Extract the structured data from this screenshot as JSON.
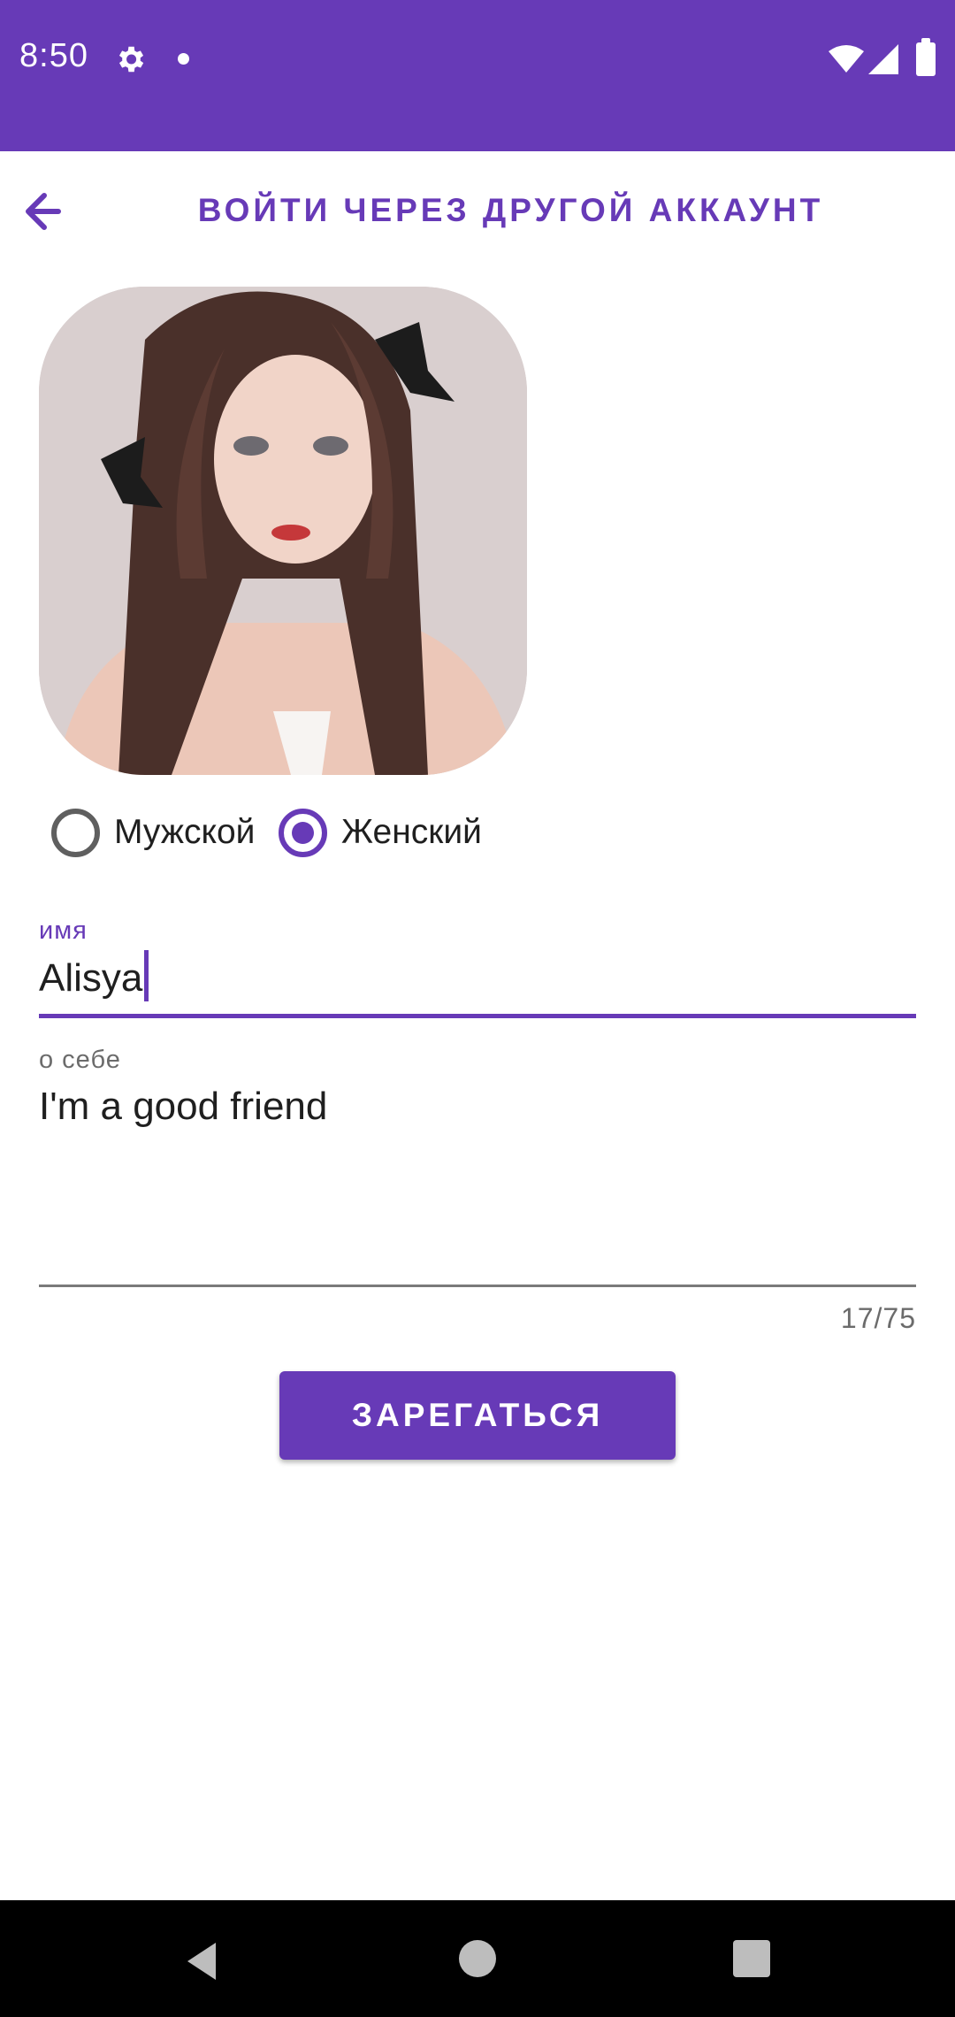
{
  "status_bar": {
    "time": "8:50",
    "icons": [
      "gear-icon",
      "notification-dot-icon",
      "wifi-icon",
      "signal-icon",
      "battery-icon"
    ]
  },
  "toolbar": {
    "back_icon": "arrow-left-icon",
    "title": "ВОЙТИ ЧЕРЕЗ ДРУГОЙ АККАУНТ"
  },
  "profile": {
    "avatar_description": "anime-style portrait avatar"
  },
  "gender": {
    "options": [
      {
        "label": "Мужской",
        "selected": false
      },
      {
        "label": "Женский",
        "selected": true
      }
    ]
  },
  "form": {
    "name_label": "имя",
    "name_value": "Alisya",
    "about_label": "о себе",
    "about_value": "I'm a good friend",
    "about_counter": "17/75"
  },
  "actions": {
    "register_label": "ЗАРЕГАТЬСЯ"
  },
  "colors": {
    "accent": "#673ab7",
    "status_bar": "#673ab7",
    "nav_bar": "#000000"
  }
}
